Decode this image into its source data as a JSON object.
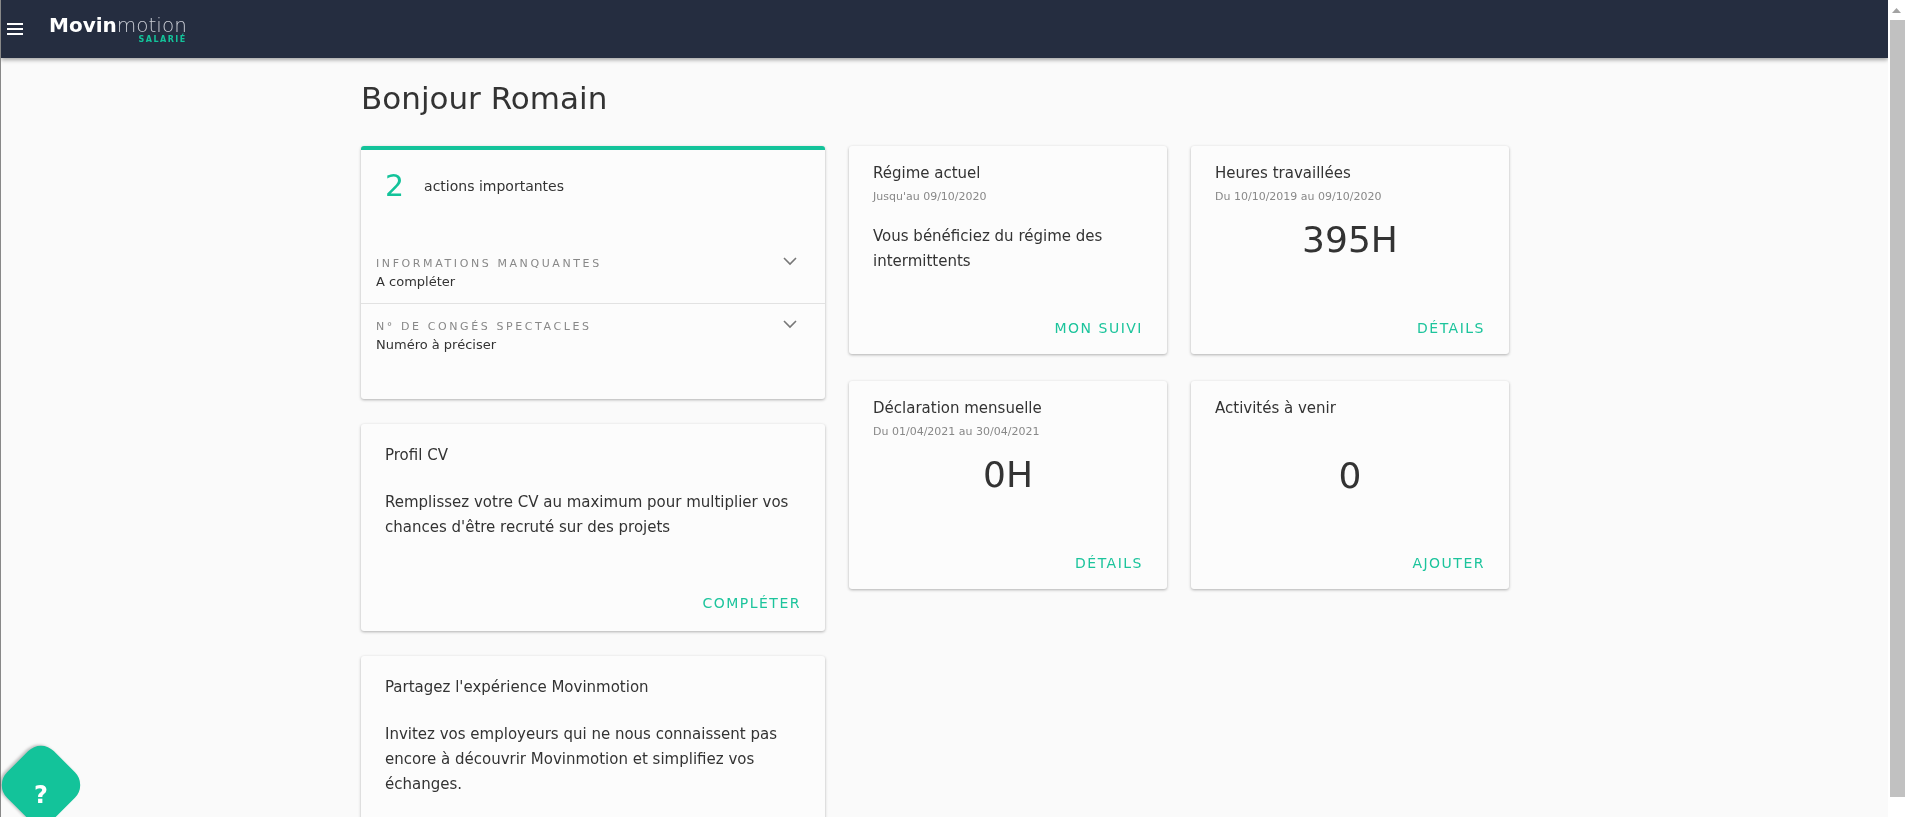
{
  "header": {
    "logo": {
      "strong": "Movin",
      "light": "motion",
      "tagline": "SALARIÉ"
    }
  },
  "greeting": "Bonjour Romain",
  "actions_card": {
    "count": "2",
    "label": "actions importantes",
    "items": [
      {
        "title": "INFORMATIONS MANQUANTES",
        "subtitle": "A compléter",
        "expanded": false
      },
      {
        "title": "N° DE CONGÉS SPECTACLES",
        "subtitle": "Numéro à préciser",
        "expanded": false
      }
    ]
  },
  "info_cards": [
    {
      "title": "Profil CV",
      "text": "Remplissez votre CV au maximum pour multiplier vos chances d'être recruté sur des projets",
      "action": "COMPLÉTER"
    },
    {
      "title": "Partagez l'expérience Movinmotion",
      "text": "Invitez vos employeurs qui ne nous connaissent pas encore à découvrir Movinmotion et simplifiez vos échanges."
    }
  ],
  "stat_cards": [
    {
      "kind": "text",
      "title": "Régime actuel",
      "subtitle": "Jusqu'au 09/10/2020",
      "body": "Vous bénéficiez du régime des intermittents",
      "action": "MON SUIVI"
    },
    {
      "kind": "value",
      "title": "Heures travaillées",
      "subtitle": "Du 10/10/2019 au 09/10/2020",
      "body": "395H",
      "action": "DÉTAILS"
    },
    {
      "kind": "value",
      "title": "Déclaration mensuelle",
      "subtitle": "Du 01/04/2021 au 30/04/2021",
      "body": "0H",
      "action": "DÉTAILS"
    },
    {
      "kind": "value",
      "title": "Activités à venir",
      "body": "0",
      "action": "AJOUTER"
    }
  ],
  "help_button": {
    "label": "?"
  }
}
